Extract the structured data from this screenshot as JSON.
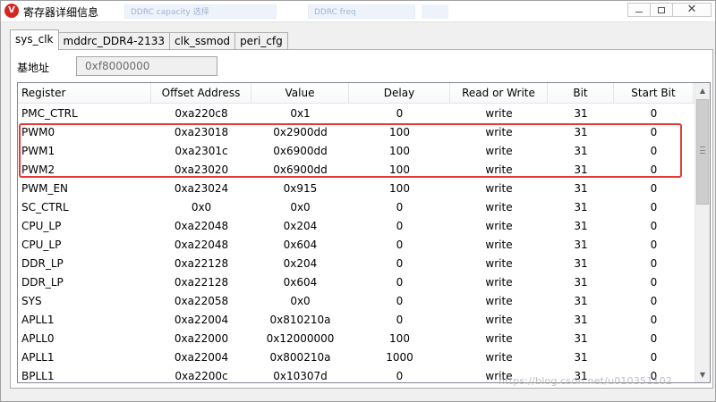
{
  "window": {
    "title": "寄存器详细信息",
    "app_icon_glyph": "V",
    "app_icon_color": "#d7261e",
    "background_ghost": [
      "DDRC capacity  选择",
      "DDRC freq  ",
      ""
    ]
  },
  "tabs": [
    {
      "label": "sys_clk",
      "active": true
    },
    {
      "label": "mddrc_DDR4-2133",
      "active": false
    },
    {
      "label": "clk_ssmod",
      "active": false
    },
    {
      "label": "peri_cfg",
      "active": false
    }
  ],
  "base_address": {
    "label": "基地址",
    "value": "0xf8000000"
  },
  "table": {
    "columns": [
      "Register",
      "Offset Address",
      "Value",
      "Delay",
      "Read or Write",
      "Bit",
      "Start Bit"
    ],
    "rows": [
      [
        "PMC_CTRL",
        "0xa220c8",
        "0x1",
        "0",
        "write",
        "31",
        "0"
      ],
      [
        "PWM0",
        "0xa23018",
        "0x2900dd",
        "100",
        "write",
        "31",
        "0"
      ],
      [
        "PWM1",
        "0xa2301c",
        "0x6900dd",
        "100",
        "write",
        "31",
        "0"
      ],
      [
        "PWM2",
        "0xa23020",
        "0x6900dd",
        "100",
        "write",
        "31",
        "0"
      ],
      [
        "PWM_EN",
        "0xa23024",
        "0x915",
        "100",
        "write",
        "31",
        "0"
      ],
      [
        "SC_CTRL",
        "0x0",
        "0x0",
        "0",
        "write",
        "31",
        "0"
      ],
      [
        "CPU_LP",
        "0xa22048",
        "0x204",
        "0",
        "write",
        "31",
        "0"
      ],
      [
        "CPU_LP",
        "0xa22048",
        "0x604",
        "0",
        "write",
        "31",
        "0"
      ],
      [
        "DDR_LP",
        "0xa22128",
        "0x204",
        "0",
        "write",
        "31",
        "0"
      ],
      [
        "DDR_LP",
        "0xa22128",
        "0x604",
        "0",
        "write",
        "31",
        "0"
      ],
      [
        "SYS",
        "0xa22058",
        "0x0",
        "0",
        "write",
        "31",
        "0"
      ],
      [
        "APLL1",
        "0xa22004",
        "0x810210a",
        "0",
        "write",
        "31",
        "0"
      ],
      [
        "APLL0",
        "0xa22000",
        "0x12000000",
        "100",
        "write",
        "31",
        "0"
      ],
      [
        "APLL1",
        "0xa22004",
        "0x800210a",
        "1000",
        "write",
        "31",
        "0"
      ],
      [
        "BPLL1",
        "0xa2200c",
        "0x10307d",
        "0",
        "write",
        "31",
        "0"
      ]
    ],
    "highlighted_rows": [
      "PWM0",
      "PWM1",
      "PWM2"
    ],
    "highlight_color": "#e53935"
  },
  "watermark": "https://blog.csdn.net/u010351102"
}
